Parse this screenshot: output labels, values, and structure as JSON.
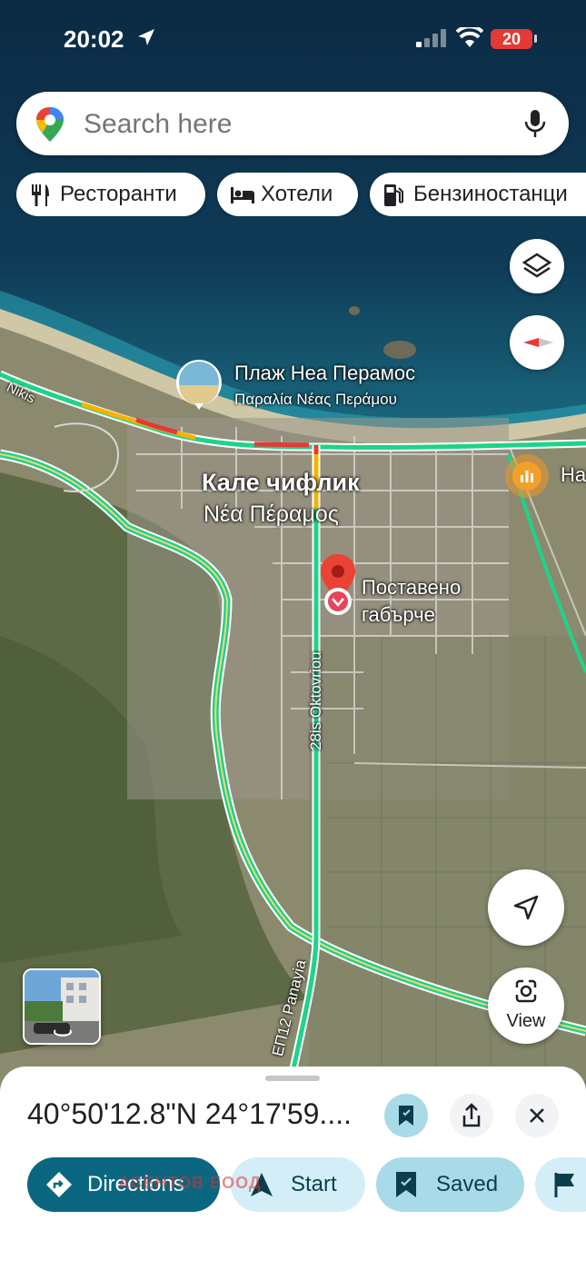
{
  "status_bar": {
    "time": "20:02",
    "battery": "20"
  },
  "search": {
    "placeholder": "Search here"
  },
  "chips": [
    {
      "label": "Ресторанти",
      "icon": "restaurant-icon"
    },
    {
      "label": "Хотели",
      "icon": "hotel-icon"
    },
    {
      "label": "Бензиностанци",
      "icon": "gas-station-icon"
    }
  ],
  "map": {
    "beach_name": "Плаж Неа Перамос",
    "beach_name_local": "Παραλία Νέας Περάμου",
    "town_name": "Кале чифлик",
    "town_name_local": "Νέα Πέραμος",
    "pin_label_line1": "Поставено",
    "pin_label_line2": "габърче",
    "road_nikis": "Nikis",
    "road_oktovriou": "28is Oktovriou",
    "road_ep12": "ЕП12 Panayia",
    "poi_partial": "На",
    "view_label": "View"
  },
  "sheet": {
    "coordinates": "40°50'12.8\"N 24°17'59....",
    "actions": [
      {
        "label": "Directions",
        "icon": "directions-icon"
      },
      {
        "label": "Start",
        "icon": "navigation-arrow-icon"
      },
      {
        "label": "Saved",
        "icon": "bookmark-icon"
      }
    ],
    "watermark": "АСЕНТОВ ЕООД"
  },
  "colors": {
    "accent": "#0b6780",
    "accent_light": "#d3eef6",
    "saved_bg": "#a8dae8",
    "pin_red": "#ea4335",
    "traffic_green": "#1ed38a"
  }
}
